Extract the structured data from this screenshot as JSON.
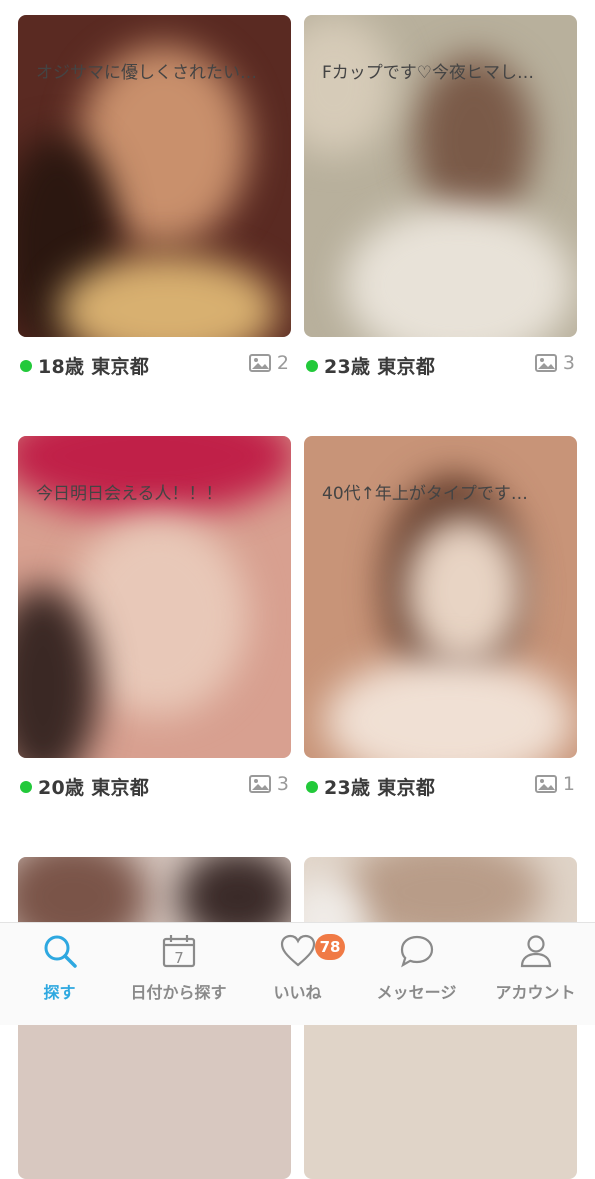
{
  "profiles": [
    {
      "age_location": "18歳 東京都",
      "photo_count": "2",
      "message": "オジサマに優しくされたい…",
      "online": true,
      "palette": [
        "#5a2a22",
        "#c9906c",
        "#2b1710",
        "#d8b070"
      ]
    },
    {
      "age_location": "23歳 東京都",
      "photo_count": "3",
      "message": "Fカップです♡今夜ヒマし…",
      "online": true,
      "palette": [
        "#b8b09c",
        "#d6cbb8",
        "#7a5a48",
        "#e8e2d8"
      ]
    },
    {
      "age_location": "20歳 東京都",
      "photo_count": "3",
      "message": "今日明日会える人！！！",
      "online": true,
      "palette": [
        "#c02048",
        "#e8c8b8",
        "#3a2824",
        "#d8a090"
      ]
    },
    {
      "age_location": "23歳 東京都",
      "photo_count": "1",
      "message": "40代↑年上がタイプです…",
      "online": true,
      "palette": [
        "#c89478",
        "#e8d4c4",
        "#5a3424",
        "#f0e0d4"
      ]
    }
  ],
  "partial_cards": [
    {
      "palette": [
        "#7a5448",
        "#d8c8c0",
        "#3a2a28",
        "#e8e0dc"
      ]
    },
    {
      "palette": [
        "#b89c88",
        "#e0d4c8",
        "#8a6c58",
        "#f0ece8"
      ]
    }
  ],
  "tabbar": {
    "tabs": [
      {
        "label": "探す",
        "icon": "search-icon",
        "active": true
      },
      {
        "label": "日付から探す",
        "icon": "calendar-icon",
        "calendar_day": "7"
      },
      {
        "label": "いいね",
        "icon": "heart-icon"
      },
      {
        "label": "メッセージ",
        "icon": "message-bubble-icon"
      },
      {
        "label": "アカウント",
        "icon": "person-icon"
      }
    ],
    "likes_badge": "78"
  },
  "colors": {
    "accent": "#2ea8e0",
    "online": "#22c93a",
    "badge": "#f07a45"
  }
}
